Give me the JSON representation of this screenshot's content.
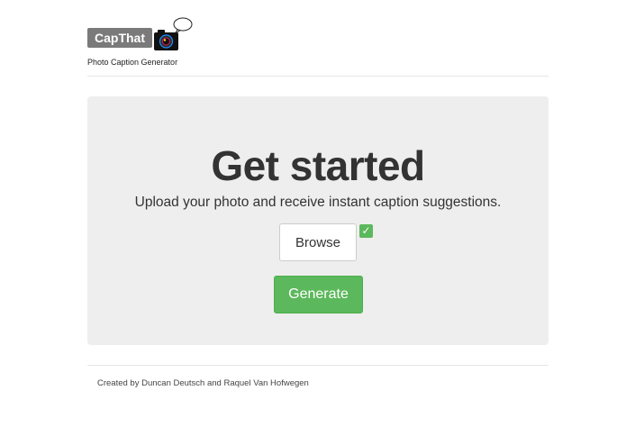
{
  "header": {
    "logo_text": "CapThat",
    "logo_icon": "camera-with-speech-bubble-icon",
    "tagline": "Photo Caption Generator"
  },
  "hero": {
    "title": "Get started",
    "subtitle": "Upload your photo and receive instant caption suggestions.",
    "browse_label": "Browse",
    "file_selected_icon": "checkmark-icon",
    "file_selected_mark": "✓",
    "generate_label": "Generate"
  },
  "footer": {
    "credits": "Created by Duncan Deutsch and Raquel Van Hofwegen"
  },
  "colors": {
    "accent_green": "#5cb85c",
    "logo_badge": "#7a7a7a",
    "jumbotron_bg": "#eeeeee",
    "text": "#333333"
  }
}
